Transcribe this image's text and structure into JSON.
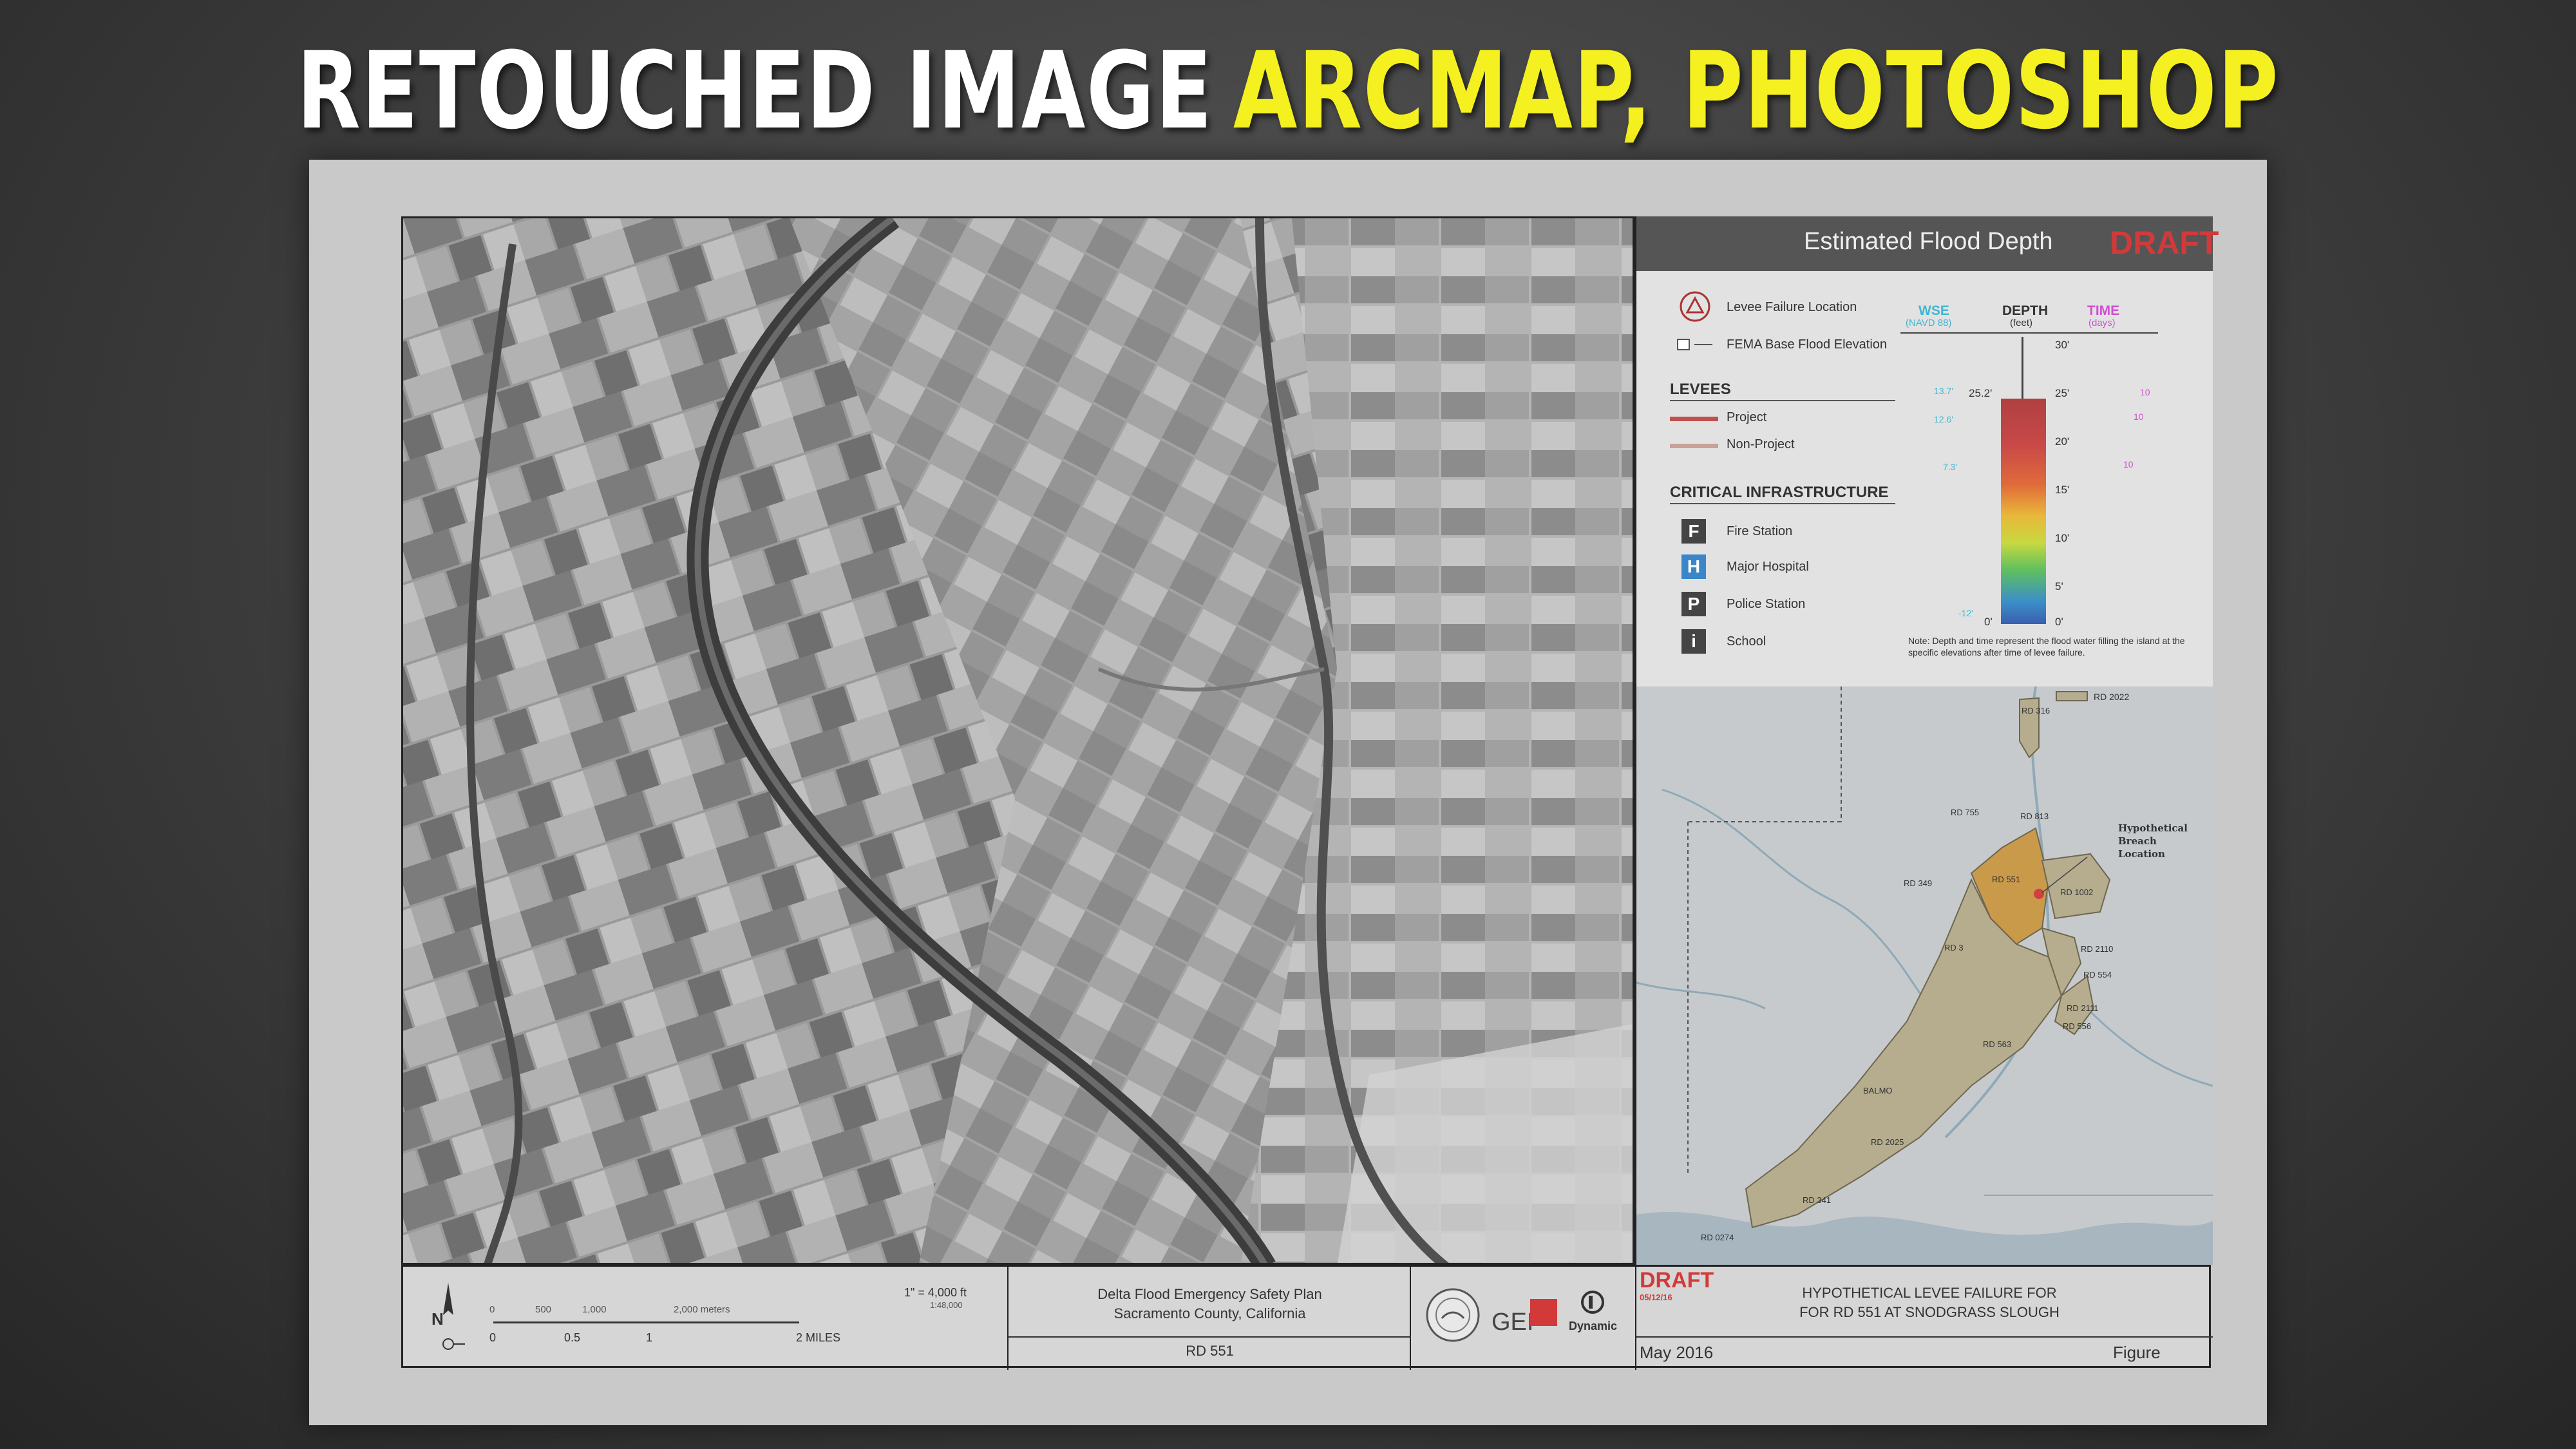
{
  "headline": {
    "white_text": "RETOUCHED IMAGE",
    "yellow_text": "ARCMAP, PHOTOSHOP"
  },
  "legend": {
    "title": "Estimated Flood Depth",
    "draft": "DRAFT",
    "levee_failure": "Levee Failure Location",
    "fema_bfe": "FEMA Base Flood Elevation",
    "levees_heading": "LEVEES",
    "project": "Project",
    "non_project": "Non-Project",
    "infra_heading": "CRITICAL INFRASTRUCTURE",
    "infra": [
      {
        "letter": "F",
        "label": "Fire Station"
      },
      {
        "letter": "H",
        "label": "Major Hospital"
      },
      {
        "letter": "P",
        "label": "Police Station"
      },
      {
        "letter": "i",
        "label": "School"
      }
    ],
    "col_wse": "WSE",
    "col_wse_sub": "(NAVD 88)",
    "col_depth": "DEPTH",
    "col_depth_sub": "(feet)",
    "col_time": "TIME",
    "col_time_sub": "(days)",
    "depth_ticks": [
      "30'",
      "25'",
      "20'",
      "15'",
      "10'",
      "5'",
      "0'"
    ],
    "left_ticks": [
      "25.2'",
      "0'"
    ],
    "wse_values": [
      "13.7'",
      "12.6'",
      "7.3'",
      "-12'"
    ],
    "time_values": [
      "10",
      "10",
      "10"
    ],
    "note": "Note: Depth and time represent the flood water filling the island at the specific elevations after time of levee failure."
  },
  "keymap_labels": {
    "rd2022": "RD 2022",
    "rd316": "RD 316",
    "rd755": "RD 755",
    "rd813": "RD 813",
    "breach": "Hypothetical Breach Location",
    "rd349": "RD 349",
    "rd551": "RD 551",
    "rd1002": "RD 1002",
    "rd3": "RD 3",
    "rd2110": "RD 2110",
    "rd554": "RD 554",
    "rd2111": "RD 2111",
    "rd556": "RD 556",
    "rd563": "RD 563",
    "rd150": "BALMO",
    "rd2025": "RD 2025",
    "rd341": "RD 341",
    "rd0274": "RD 0274"
  },
  "titleblock": {
    "scale_text": "1\" = 4,000 ft",
    "scale_sub": "1:48,000",
    "feet_ticks": [
      "0",
      "500",
      "1,000",
      "2,000 meters"
    ],
    "mile_ticks": [
      "0",
      "0.5",
      "1",
      "2 MILES"
    ],
    "north": "N",
    "project_line1": "Delta Flood Emergency Safety Plan",
    "project_line2": "Sacramento County, California",
    "rd": "RD 551",
    "gei": "GEI",
    "dynamic": "Dynamic",
    "draft": "DRAFT",
    "draft_date": "05/12/16",
    "title_line1": "HYPOTHETICAL LEVEE FAILURE FOR",
    "title_line2": "FOR RD 551 AT SNODGRASS SLOUGH",
    "date": "May 2016",
    "figure": "Figure"
  },
  "colors": {
    "draft_red": "#d23a3a",
    "headline_yellow": "#f5f020",
    "wse_cyan": "#3fb7d4",
    "time_magenta": "#d04ed0",
    "project_levee": "#c0504d",
    "non_project_levee": "#c9a09a",
    "island_fill": "#b6ad8e",
    "breach_island": "#c99a4a"
  }
}
